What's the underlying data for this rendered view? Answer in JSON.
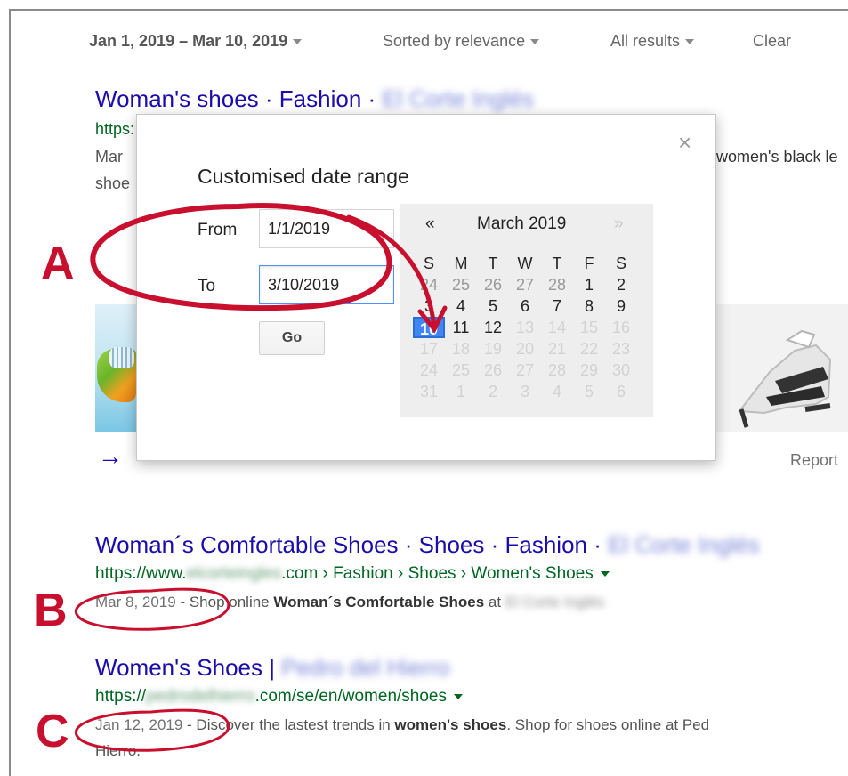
{
  "toolbar": {
    "date_range": "Jan 1, 2019 – Mar 10, 2019",
    "sort": "Sorted by relevance",
    "results_filter": "All results",
    "clear": "Clear"
  },
  "results": [
    {
      "title": "Woman's shoes · Fashion · ",
      "title_blurred": "El Corte Inglés",
      "url_visible": "https:",
      "snippet_line1": "Mar",
      "snippet_line2": "shoe",
      "snippet_right": "women's black le",
      "report": "Report"
    },
    {
      "title": "Woman´s Comfortable Shoes · Shoes · Fashion · ",
      "title_blurred": "El Corte Inglés",
      "url_prefix": "https://www.",
      "url_blurred": "elcorteingles",
      "url_suffix": ".com › Fashion › Shoes › Women's Shoes",
      "date": "Mar 8, 2019",
      "snippet_prefix": " - Shop online ",
      "snippet_bold1": "Woman´s Comfortable ",
      "snippet_bold2": "Shoes",
      "snippet_mid": " at ",
      "snippet_blurred": "El Corte Inglés"
    },
    {
      "title": "Women's Shoes | ",
      "title_blurred": "Pedro del Hierro",
      "url_prefix": "https://",
      "url_blurred": "pedrodelhierro",
      "url_suffix": ".com/se/en/women/shoes",
      "date": "Jan 12, 2019",
      "snippet_prefix": " - Discover the lastest trends in ",
      "snippet_bold": "women's shoes",
      "snippet_suffix": ". Shop for shoes online at Ped",
      "snippet_line2": "Hierro."
    }
  ],
  "dialog": {
    "title": "Customised date range",
    "from_label": "From",
    "from_value": "1/1/2019",
    "to_label": "To",
    "to_value": "3/10/2019",
    "go_label": "Go",
    "close": "×",
    "calendar": {
      "prev": "«",
      "next": "»",
      "month": "March 2019",
      "weekdays": [
        "S",
        "M",
        "T",
        "W",
        "T",
        "F",
        "S"
      ],
      "weeks": [
        [
          "24",
          "25",
          "26",
          "27",
          "28",
          "1",
          "2"
        ],
        [
          "3",
          "4",
          "5",
          "6",
          "7",
          "8",
          "9"
        ],
        [
          "10",
          "11",
          "12",
          "13",
          "14",
          "15",
          "16"
        ],
        [
          "17",
          "18",
          "19",
          "20",
          "21",
          "22",
          "23"
        ],
        [
          "24",
          "25",
          "26",
          "27",
          "28",
          "29",
          "30"
        ],
        [
          "31",
          "1",
          "2",
          "3",
          "4",
          "5",
          "6"
        ]
      ],
      "selected_day": "10"
    }
  },
  "annotations": {
    "a": "A",
    "b": "B",
    "c": "C",
    "color": "#c8102e"
  }
}
